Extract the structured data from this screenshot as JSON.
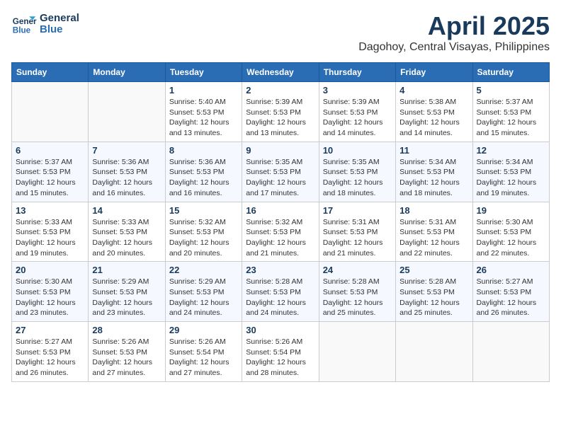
{
  "logo": {
    "line1": "General",
    "line2": "Blue"
  },
  "title": "April 2025",
  "subtitle": "Dagohoy, Central Visayas, Philippines",
  "header": {
    "days": [
      "Sunday",
      "Monday",
      "Tuesday",
      "Wednesday",
      "Thursday",
      "Friday",
      "Saturday"
    ]
  },
  "weeks": [
    [
      {
        "num": "",
        "info": ""
      },
      {
        "num": "",
        "info": ""
      },
      {
        "num": "1",
        "info": "Sunrise: 5:40 AM\nSunset: 5:53 PM\nDaylight: 12 hours and 13 minutes."
      },
      {
        "num": "2",
        "info": "Sunrise: 5:39 AM\nSunset: 5:53 PM\nDaylight: 12 hours and 13 minutes."
      },
      {
        "num": "3",
        "info": "Sunrise: 5:39 AM\nSunset: 5:53 PM\nDaylight: 12 hours and 14 minutes."
      },
      {
        "num": "4",
        "info": "Sunrise: 5:38 AM\nSunset: 5:53 PM\nDaylight: 12 hours and 14 minutes."
      },
      {
        "num": "5",
        "info": "Sunrise: 5:37 AM\nSunset: 5:53 PM\nDaylight: 12 hours and 15 minutes."
      }
    ],
    [
      {
        "num": "6",
        "info": "Sunrise: 5:37 AM\nSunset: 5:53 PM\nDaylight: 12 hours and 15 minutes."
      },
      {
        "num": "7",
        "info": "Sunrise: 5:36 AM\nSunset: 5:53 PM\nDaylight: 12 hours and 16 minutes."
      },
      {
        "num": "8",
        "info": "Sunrise: 5:36 AM\nSunset: 5:53 PM\nDaylight: 12 hours and 16 minutes."
      },
      {
        "num": "9",
        "info": "Sunrise: 5:35 AM\nSunset: 5:53 PM\nDaylight: 12 hours and 17 minutes."
      },
      {
        "num": "10",
        "info": "Sunrise: 5:35 AM\nSunset: 5:53 PM\nDaylight: 12 hours and 18 minutes."
      },
      {
        "num": "11",
        "info": "Sunrise: 5:34 AM\nSunset: 5:53 PM\nDaylight: 12 hours and 18 minutes."
      },
      {
        "num": "12",
        "info": "Sunrise: 5:34 AM\nSunset: 5:53 PM\nDaylight: 12 hours and 19 minutes."
      }
    ],
    [
      {
        "num": "13",
        "info": "Sunrise: 5:33 AM\nSunset: 5:53 PM\nDaylight: 12 hours and 19 minutes."
      },
      {
        "num": "14",
        "info": "Sunrise: 5:33 AM\nSunset: 5:53 PM\nDaylight: 12 hours and 20 minutes."
      },
      {
        "num": "15",
        "info": "Sunrise: 5:32 AM\nSunset: 5:53 PM\nDaylight: 12 hours and 20 minutes."
      },
      {
        "num": "16",
        "info": "Sunrise: 5:32 AM\nSunset: 5:53 PM\nDaylight: 12 hours and 21 minutes."
      },
      {
        "num": "17",
        "info": "Sunrise: 5:31 AM\nSunset: 5:53 PM\nDaylight: 12 hours and 21 minutes."
      },
      {
        "num": "18",
        "info": "Sunrise: 5:31 AM\nSunset: 5:53 PM\nDaylight: 12 hours and 22 minutes."
      },
      {
        "num": "19",
        "info": "Sunrise: 5:30 AM\nSunset: 5:53 PM\nDaylight: 12 hours and 22 minutes."
      }
    ],
    [
      {
        "num": "20",
        "info": "Sunrise: 5:30 AM\nSunset: 5:53 PM\nDaylight: 12 hours and 23 minutes."
      },
      {
        "num": "21",
        "info": "Sunrise: 5:29 AM\nSunset: 5:53 PM\nDaylight: 12 hours and 23 minutes."
      },
      {
        "num": "22",
        "info": "Sunrise: 5:29 AM\nSunset: 5:53 PM\nDaylight: 12 hours and 24 minutes."
      },
      {
        "num": "23",
        "info": "Sunrise: 5:28 AM\nSunset: 5:53 PM\nDaylight: 12 hours and 24 minutes."
      },
      {
        "num": "24",
        "info": "Sunrise: 5:28 AM\nSunset: 5:53 PM\nDaylight: 12 hours and 25 minutes."
      },
      {
        "num": "25",
        "info": "Sunrise: 5:28 AM\nSunset: 5:53 PM\nDaylight: 12 hours and 25 minutes."
      },
      {
        "num": "26",
        "info": "Sunrise: 5:27 AM\nSunset: 5:53 PM\nDaylight: 12 hours and 26 minutes."
      }
    ],
    [
      {
        "num": "27",
        "info": "Sunrise: 5:27 AM\nSunset: 5:53 PM\nDaylight: 12 hours and 26 minutes."
      },
      {
        "num": "28",
        "info": "Sunrise: 5:26 AM\nSunset: 5:53 PM\nDaylight: 12 hours and 27 minutes."
      },
      {
        "num": "29",
        "info": "Sunrise: 5:26 AM\nSunset: 5:54 PM\nDaylight: 12 hours and 27 minutes."
      },
      {
        "num": "30",
        "info": "Sunrise: 5:26 AM\nSunset: 5:54 PM\nDaylight: 12 hours and 28 minutes."
      },
      {
        "num": "",
        "info": ""
      },
      {
        "num": "",
        "info": ""
      },
      {
        "num": "",
        "info": ""
      }
    ]
  ]
}
